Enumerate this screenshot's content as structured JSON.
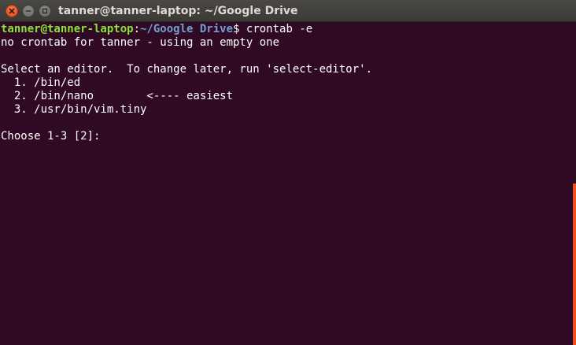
{
  "window": {
    "title": "tanner@tanner-laptop: ~/Google Drive",
    "buttons": {
      "close": "close-icon",
      "minimize": "minimize-icon",
      "maximize": "maximize-icon"
    }
  },
  "terminal": {
    "prompt": {
      "user_host": "tanner@tanner-laptop",
      "separator": ":",
      "path": "~/Google Drive",
      "symbol": "$ ",
      "command": "crontab -e"
    },
    "lines": [
      "no crontab for tanner - using an empty one",
      "",
      "Select an editor.  To change later, run 'select-editor'.",
      "  1. /bin/ed",
      "  2. /bin/nano        <---- easiest",
      "  3. /usr/bin/vim.tiny",
      "",
      "Choose 1-3 [2]: "
    ]
  },
  "colors": {
    "background": "#300a24",
    "user_host": "#8ae234",
    "path": "#729fcf",
    "text": "#ffffff",
    "scroll_thumb": "#e95420"
  }
}
